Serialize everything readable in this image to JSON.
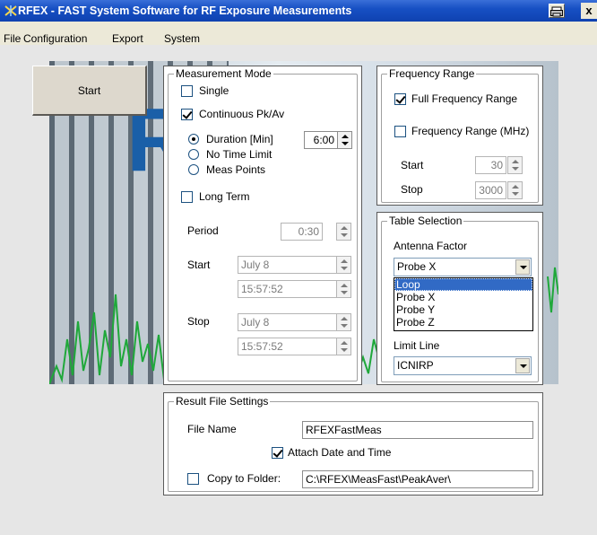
{
  "window": {
    "title": "RFEX - FAST System Software for RF Exposure Measurements",
    "icon": "rfex-app-icon",
    "close_glyph": "x",
    "sys_glyph": "printer-icon"
  },
  "menu": [
    "File",
    "Configuration",
    "Export",
    "System"
  ],
  "start_button": "Start",
  "measurement_mode": {
    "legend": "Measurement Mode",
    "single": {
      "label": "Single",
      "checked": false
    },
    "continuous": {
      "label": "Continuous Pk/Av",
      "checked": true
    },
    "duration": {
      "label": "Duration [Min]",
      "selected": true,
      "value": "6:00"
    },
    "no_time_limit": {
      "label": "No Time Limit",
      "selected": false
    },
    "meas_points": {
      "label": "Meas Points",
      "selected": false
    },
    "long_term": {
      "label": "Long Term",
      "checked": false
    },
    "period": {
      "label": "Period",
      "value": "0:30"
    },
    "start": {
      "label": "Start",
      "date": "July 8",
      "time": "15:57:52"
    },
    "stop": {
      "label": "Stop",
      "date": "July 8",
      "time": "15:57:52"
    }
  },
  "frequency_range": {
    "legend": "Frequency Range",
    "full": {
      "label": "Full Frequency Range",
      "checked": true
    },
    "custom": {
      "label": "Frequency Range (MHz)",
      "checked": false
    },
    "start": {
      "label": "Start",
      "value": "30"
    },
    "stop": {
      "label": "Stop",
      "value": "3000"
    }
  },
  "table_selection": {
    "legend": "Table Selection",
    "antenna_factor": {
      "label": "Antenna Factor",
      "value": "Probe X",
      "options": [
        "Loop",
        "Probe X",
        "Probe Y",
        "Probe Z"
      ],
      "highlighted": "Loop"
    },
    "limit_line": {
      "label": "Limit Line",
      "value": "ICNIRP"
    }
  },
  "result_file": {
    "legend": "Result File Settings",
    "file_name": {
      "label": "File Name",
      "value": "RFEXFastMeas"
    },
    "attach": {
      "label": "Attach Date and Time",
      "checked": true
    },
    "copy": {
      "label": "Copy to Folder:",
      "checked": false,
      "value": "C:\\RFEX\\MeasFast\\PeakAver\\"
    }
  },
  "colors": {
    "title_bar": "#1750c4",
    "selection": "#316ac5",
    "client_bg": "#e6e6e6",
    "logo_blue": "#1a5fa8",
    "spectrum_green": "#1fa83a"
  }
}
